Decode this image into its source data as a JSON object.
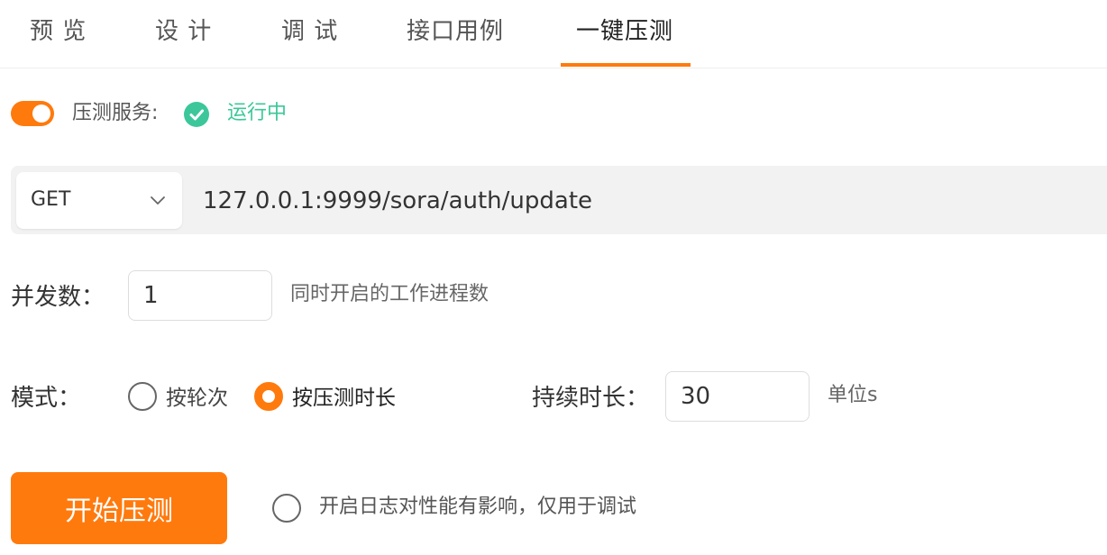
{
  "tabs": [
    {
      "label": "预 览"
    },
    {
      "label": "设 计"
    },
    {
      "label": "调 试"
    },
    {
      "label": "接口用例"
    },
    {
      "label": "一键压测"
    }
  ],
  "active_tab": "一键压测",
  "accent_color": "#ff7a0d",
  "status_color": "#3cc79a",
  "service": {
    "label": "压测服务:",
    "status": "运行中",
    "enabled": true,
    "status_icon": "check-circle-icon"
  },
  "request": {
    "method": "GET",
    "url": "127.0.0.1:9999/sora/auth/update"
  },
  "concurrency": {
    "label": "并发数：",
    "value": "1",
    "hint": "同时开启的工作进程数"
  },
  "mode": {
    "label": "模式：",
    "options": [
      {
        "label": "按轮次",
        "checked": false
      },
      {
        "label": "按压测时长",
        "checked": true
      }
    ]
  },
  "duration": {
    "label": "持续时长：",
    "value": "30",
    "unit": "单位s"
  },
  "actions": {
    "start_label": "开始压测",
    "log_option_label": "开启日志对性能有影响，仅用于调试",
    "log_enabled": false
  }
}
